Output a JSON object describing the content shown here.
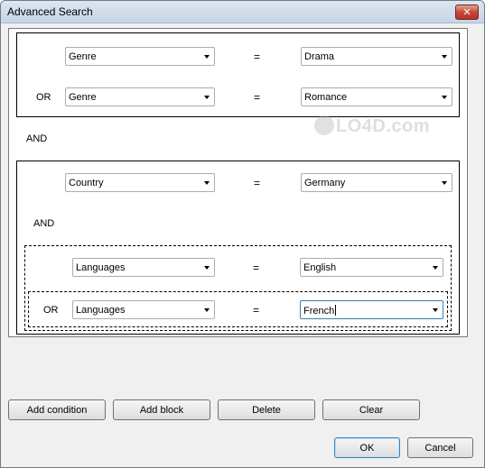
{
  "window": {
    "title": "Advanced Search",
    "close_label": "✕"
  },
  "block1": {
    "rows": [
      {
        "prefix": "",
        "field": "Genre",
        "operator": "=",
        "value": "Drama"
      },
      {
        "prefix": "OR",
        "field": "Genre",
        "operator": "=",
        "value": "Romance"
      }
    ]
  },
  "between_blocks_label": "AND",
  "block2": {
    "rows": [
      {
        "prefix": "",
        "field": "Country",
        "operator": "=",
        "value": "Germany"
      }
    ],
    "inner_connector": "AND",
    "inner_group": {
      "rows": [
        {
          "prefix": "",
          "field": "Languages",
          "operator": "=",
          "value": "English"
        },
        {
          "prefix": "OR",
          "field": "Languages",
          "operator": "=",
          "value": "French"
        }
      ]
    }
  },
  "buttons": {
    "add_condition": "Add condition",
    "add_block": "Add block",
    "delete": "Delete",
    "clear": "Clear",
    "ok": "OK",
    "cancel": "Cancel"
  },
  "watermark": {
    "text": "LO4D.com"
  }
}
